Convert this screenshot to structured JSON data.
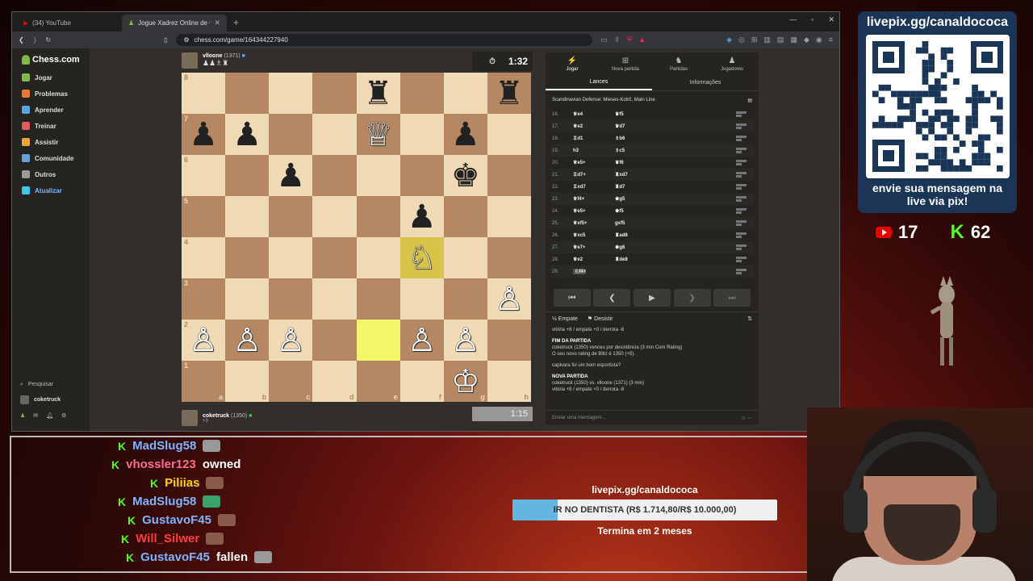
{
  "browser": {
    "tabs": [
      {
        "label": "(34) YouTube",
        "active": false
      },
      {
        "label": "Jogue Xadrez Online de GRÁ...",
        "active": true
      }
    ],
    "url": "chess.com/game/164344227940"
  },
  "site": {
    "logo": "Chess.com",
    "nav": [
      {
        "label": "Jogar",
        "icon": "play-icon",
        "color": "#81b64c"
      },
      {
        "label": "Problemas",
        "icon": "puzzle-icon",
        "color": "#e8753a"
      },
      {
        "label": "Aprender",
        "icon": "learn-icon",
        "color": "#5aa7e0"
      },
      {
        "label": "Treinar",
        "icon": "train-icon",
        "color": "#e35b5b"
      },
      {
        "label": "Assistir",
        "icon": "watch-icon",
        "color": "#e8a33a"
      },
      {
        "label": "Comunidade",
        "icon": "community-icon",
        "color": "#6aa0d8"
      },
      {
        "label": "Outros",
        "icon": "more-icon",
        "color": "#999999"
      },
      {
        "label": "Atualizar",
        "icon": "diamond-icon",
        "color": "#3fc6e8"
      }
    ],
    "search_label": "Pesquisar",
    "username": "coketruck"
  },
  "game": {
    "top_player": {
      "name": "vlloone",
      "rating": "(1371)",
      "clock": "1:32",
      "captured": "♟♟♗♜"
    },
    "bottom_player": {
      "name": "coketruck",
      "rating": "(1350)",
      "clock": "1:15",
      "captured_score": "+3"
    },
    "files": [
      "a",
      "b",
      "c",
      "d",
      "e",
      "f",
      "g",
      "h"
    ],
    "ranks": [
      "8",
      "7",
      "6",
      "5",
      "4",
      "3",
      "2",
      "1"
    ],
    "board": [
      [
        "",
        "",
        "",
        "",
        "br",
        "",
        "",
        "br"
      ],
      [
        "bp",
        "bp",
        "",
        "",
        "wq",
        "",
        "bp",
        ""
      ],
      [
        "",
        "",
        "bp",
        "",
        "",
        "",
        "bk",
        ""
      ],
      [
        "",
        "",
        "",
        "",
        "",
        "bp",
        "",
        ""
      ],
      [
        "",
        "",
        "",
        "",
        "",
        "wn",
        "",
        ""
      ],
      [
        "",
        "",
        "",
        "",
        "",
        "",
        "",
        "wp"
      ],
      [
        "wp",
        "wp",
        "wp",
        "",
        "",
        "wp",
        "wp",
        ""
      ],
      [
        "",
        "",
        "",
        "",
        "",
        "",
        "wk",
        ""
      ]
    ],
    "highlights": [
      "e2",
      "f4"
    ]
  },
  "panel": {
    "tabs": [
      {
        "label": "Jogar",
        "icon": "bolt-icon",
        "active": true
      },
      {
        "label": "Nova partida",
        "icon": "plus-icon",
        "active": false
      },
      {
        "label": "Partidas",
        "icon": "games-icon",
        "active": false
      },
      {
        "label": "Jogadores",
        "icon": "players-icon",
        "active": false
      }
    ],
    "subtabs": [
      "Lances",
      "Informações"
    ],
    "opening": "Scandinavian Defense: Mieses-Kotrč, Main Line",
    "moves": [
      {
        "n": "16.",
        "w": "♕e4",
        "b": "♛f5"
      },
      {
        "n": "17.",
        "w": "♕e2",
        "b": "♛d7"
      },
      {
        "n": "18.",
        "w": "♖d1",
        "b": "♗b6"
      },
      {
        "n": "19.",
        "w": "h3",
        "b": "♗c5"
      },
      {
        "n": "20.",
        "w": "♕e5+",
        "b": "♛f6"
      },
      {
        "n": "21.",
        "w": "♖d7+",
        "b": "♜xd7"
      },
      {
        "n": "22.",
        "w": "♖xd7",
        "b": "♜d7"
      },
      {
        "n": "23.",
        "w": "♕f4+",
        "b": "♚g5"
      },
      {
        "n": "24.",
        "w": "♕e5+",
        "b": "♚f5"
      },
      {
        "n": "25.",
        "w": "♕xf5+",
        "b": "gxf5"
      },
      {
        "n": "26.",
        "w": "♕xc5",
        "b": "♜ad8"
      },
      {
        "n": "27.",
        "w": "♕e7+",
        "b": "♚g6"
      },
      {
        "n": "28.",
        "w": "♕e2",
        "b": "♜de8"
      },
      {
        "n": "29.",
        "w": "♘f4+",
        "b": ""
      }
    ],
    "actions": {
      "draw": "Empate",
      "resign": "Desistir"
    },
    "chat": [
      {
        "text": "vitória +8 / empate +0 / derrota -8",
        "bold": false
      },
      {
        "text": "FIM DA PARTIDA",
        "bold": true
      },
      {
        "text": "coketruck (1350) venceu por desistência (3 min Com Rating)",
        "bold": false
      },
      {
        "text": "O seu novo rating de Blitz é 1350 (+8).",
        "bold": false
      },
      {
        "text": "capivara foi um bom esportista?",
        "bold": false
      },
      {
        "text": "NOVA PARTIDA",
        "bold": true
      },
      {
        "text": "coketruck (1350) vs. vlloone (1371) (3 min)",
        "bold": false
      },
      {
        "text": "vitória +8 / empate +0 / derrota -8",
        "bold": false
      }
    ],
    "chat_placeholder": "Enviar uma mensagem..."
  },
  "overlay": {
    "qr_title": "livepix.gg/canaldococa",
    "qr_text": "envie sua mensagem na live via pix!",
    "youtube_count": "17",
    "kick_count": "62",
    "chat": [
      {
        "user": "MadSlug58",
        "color": "#7fb3ff",
        "msg": "",
        "emote": "grey"
      },
      {
        "user": "vhossler123",
        "color": "#ff6b8b",
        "msg": "owned",
        "emote": ""
      },
      {
        "user": "Piliias",
        "color": "#ffd400",
        "msg": "",
        "emote": "brown"
      },
      {
        "user": "MadSlug58",
        "color": "#7fb3ff",
        "msg": "",
        "emote": "green"
      },
      {
        "user": "GustavoF45",
        "color": "#7fb3ff",
        "msg": "",
        "emote": "brown"
      },
      {
        "user": "Will_Silwer",
        "color": "#ff3b3b",
        "msg": "",
        "emote": "brown"
      },
      {
        "user": "GustavoF45",
        "color": "#7fb3ff",
        "msg": "fallen",
        "emote": "grey"
      }
    ],
    "goal": {
      "url": "livepix.gg/canaldococa",
      "label": "IR NO DENTISTA (R$ 1.714,80/R$ 10.000,00)",
      "progress": 0.1715,
      "ends": "Termina em 2 meses"
    }
  }
}
